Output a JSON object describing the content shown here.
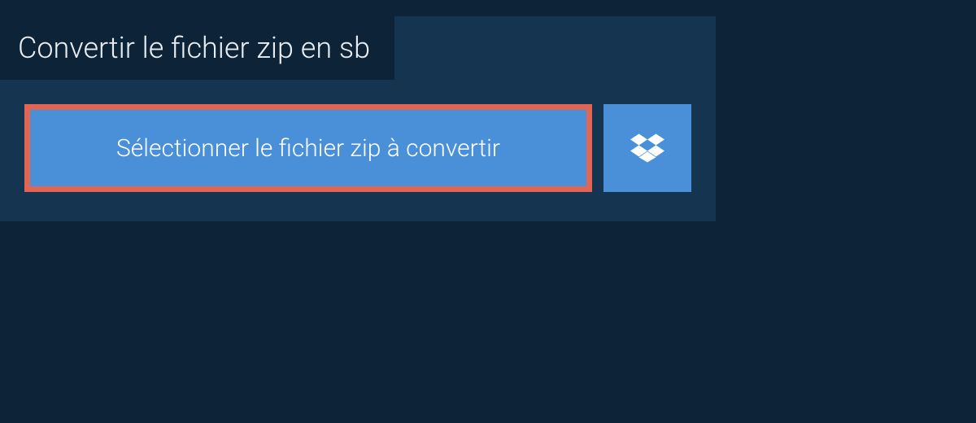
{
  "title": "Convertir le fichier zip en sb",
  "buttons": {
    "select_label": "Sélectionner le fichier zip à convertir"
  }
}
